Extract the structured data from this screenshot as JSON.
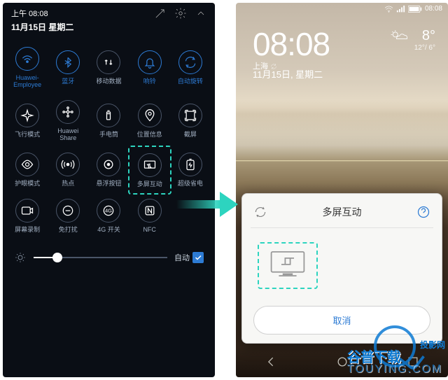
{
  "left": {
    "status_time": "上午 08:08",
    "date": "11月15日 星期二",
    "tiles": [
      {
        "label": "Huawei-\nEmployee",
        "icon": "wifi",
        "on": true
      },
      {
        "label": "蓝牙",
        "icon": "bluetooth",
        "on": true
      },
      {
        "label": "移动数据",
        "icon": "data",
        "on": false
      },
      {
        "label": "响铃",
        "icon": "bell",
        "on": true
      },
      {
        "label": "自动旋转",
        "icon": "rotate",
        "on": true
      },
      {
        "label": "飞行模式",
        "icon": "airplane",
        "on": false
      },
      {
        "label": "Huawei Share",
        "icon": "share",
        "on": false
      },
      {
        "label": "手电筒",
        "icon": "torch",
        "on": false
      },
      {
        "label": "位置信息",
        "icon": "location",
        "on": false
      },
      {
        "label": "截屏",
        "icon": "screenshot",
        "on": false
      },
      {
        "label": "护眼模式",
        "icon": "eye",
        "on": false
      },
      {
        "label": "热点",
        "icon": "hotspot",
        "on": false
      },
      {
        "label": "悬浮按钮",
        "icon": "float",
        "on": false
      },
      {
        "label": "多屏互动",
        "icon": "cast",
        "on": false,
        "highlight": true
      },
      {
        "label": "超级省电",
        "icon": "battery",
        "on": false
      },
      {
        "label": "屏幕录制",
        "icon": "record",
        "on": false
      },
      {
        "label": "免打扰",
        "icon": "dnd",
        "on": false
      },
      {
        "label": "4G 开关",
        "icon": "4g",
        "on": false
      },
      {
        "label": "NFC",
        "icon": "nfc",
        "on": false
      }
    ],
    "brightness_auto": "自动",
    "brightness_pct": 18
  },
  "right": {
    "status_time": "08:08",
    "clock": "08:08",
    "location": "上海",
    "date": "11月15日, 星期二",
    "temp": "8°",
    "temp_range": "12°/ 6°",
    "dialog_title": "多屏互动",
    "cancel": "取消"
  },
  "watermark": {
    "txt1": "投影网",
    "txt2": "谷普下载",
    "sub": "TOUYING.COM",
    "center": "t u y i n g . c o m"
  }
}
